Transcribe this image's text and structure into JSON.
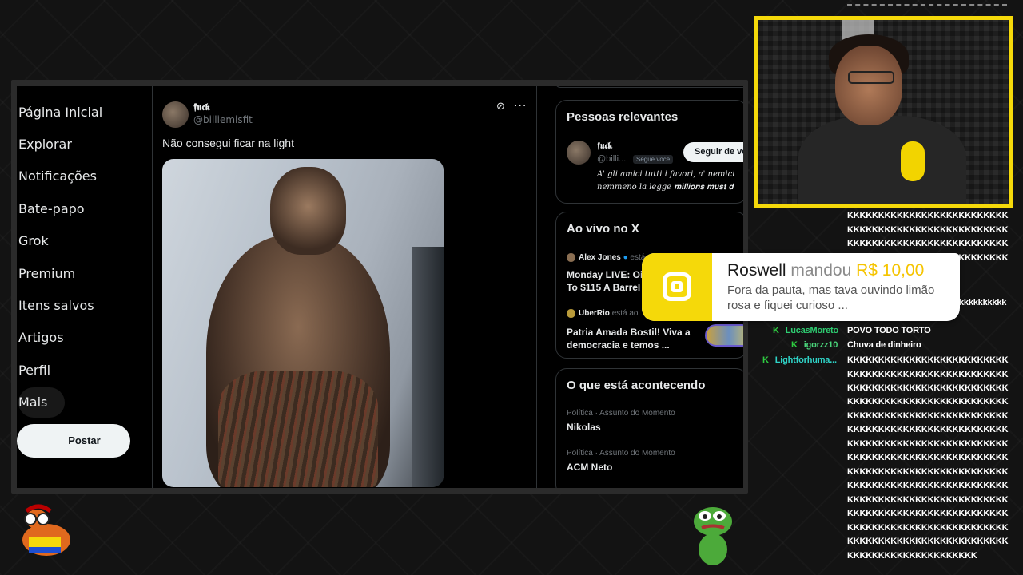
{
  "nav": {
    "items": [
      "Página Inicial",
      "Explorar",
      "Notificações",
      "Bate-papo",
      "Grok",
      "Premium",
      "Itens salvos",
      "Artigos",
      "Perfil",
      "Mais"
    ],
    "post_label": "Postar"
  },
  "tweet": {
    "name": "𝖋𝖚𝖈𝖐",
    "handle": "@billiemisfit",
    "text": "Não consegui ficar na light"
  },
  "relevant": {
    "title": "Pessoas relevantes",
    "name": "𝖋𝖚𝖈𝖐",
    "handle": "@billi...",
    "follows_you": "Segue você",
    "follow_label": "Seguir de volta",
    "bio_line1": "A' gli amici tutti i favori, a' nemici",
    "bio_line2": "nemmeno la legge 𝐦𝐢𝐥𝐥𝐢𝐨𝐧𝐬 𝐦𝐮𝐬𝐭 𝐝"
  },
  "live": {
    "title": "Ao vivo no X",
    "items": [
      {
        "host": "Alex Jones",
        "status": "está",
        "headline1": "Monday LIVE: Oil",
        "headline2": "To $115 A Barrel"
      },
      {
        "host": "UberRio",
        "status": "está ao",
        "headline1": "Patria Amada Bostil! Viva a",
        "headline2": "democracia e temos ..."
      }
    ]
  },
  "trends": {
    "title": "O que está acontecendo",
    "items": [
      {
        "category": "Política · Assunto do Momento",
        "name": "Nikolas"
      },
      {
        "category": "Política · Assunto do Momento",
        "name": "ACM Neto"
      }
    ]
  },
  "donation": {
    "user": "Roswell",
    "verb": "mandou",
    "amount": "R$ 10,00",
    "message": "Fora da pauta, mas tava ouvindo limão rosa e fiquei curioso ..."
  },
  "chat": {
    "kk_top": [
      "KKKKKKKKKKKKKKKKKKKKKKKKKK",
      "KKKKKKKKKKKKKKKKKKKKKKKKKK",
      "KKKKKKKKKKKKKKKKKKKKKKKKKK",
      "KKKKKKKKKKKKKKKKKKKKKKKKKK"
    ],
    "kk_partial": "kkkkkkkkkk",
    "users": [
      {
        "badge": "K",
        "name": "LucasMoreto",
        "message": "POVO TODO TORTO"
      },
      {
        "badge": "K",
        "name": "igorzz10",
        "message": "Chuva de dinheiro"
      },
      {
        "badge": "K",
        "name": "Lightforhuma...",
        "message": "KKKKKKKKKKKKKKKKKKKKKKKKKK"
      }
    ],
    "kk_bottom": [
      "KKKKKKKKKKKKKKKKKKKKKKKKKK",
      "KKKKKKKKKKKKKKKKKKKKKKKKKK",
      "KKKKKKKKKKKKKKKKKKKKKKKKKK",
      "KKKKKKKKKKKKKKKKKKKKKKKKKK",
      "KKKKKKKKKKKKKKKKKKKKKKKKKK",
      "KKKKKKKKKKKKKKKKKKKKKKKKKK",
      "KKKKKKKKKKKKKKKKKKKKKKKKKK",
      "KKKKKKKKKKKKKKKKKKKKKKKKKK",
      "KKKKKKKKKKKKKKKKKKKKKKKKKK",
      "KKKKKKKKKKKKKKKKKKKKKKKKKK",
      "KKKKKKKKKKKKKKKKKKKKKKKKKK",
      "KKKKKKKKKKKKKKKKKKKKKKKKKK",
      "KKKKKKKKKKKKKKKKKKKKKKKKKK",
      "KKKKKKKKKKKKKKKKKKKKK"
    ]
  },
  "colors": {
    "accent": "#f5d90a",
    "x_bg": "#000000",
    "chat_user": "#2ecc71"
  }
}
